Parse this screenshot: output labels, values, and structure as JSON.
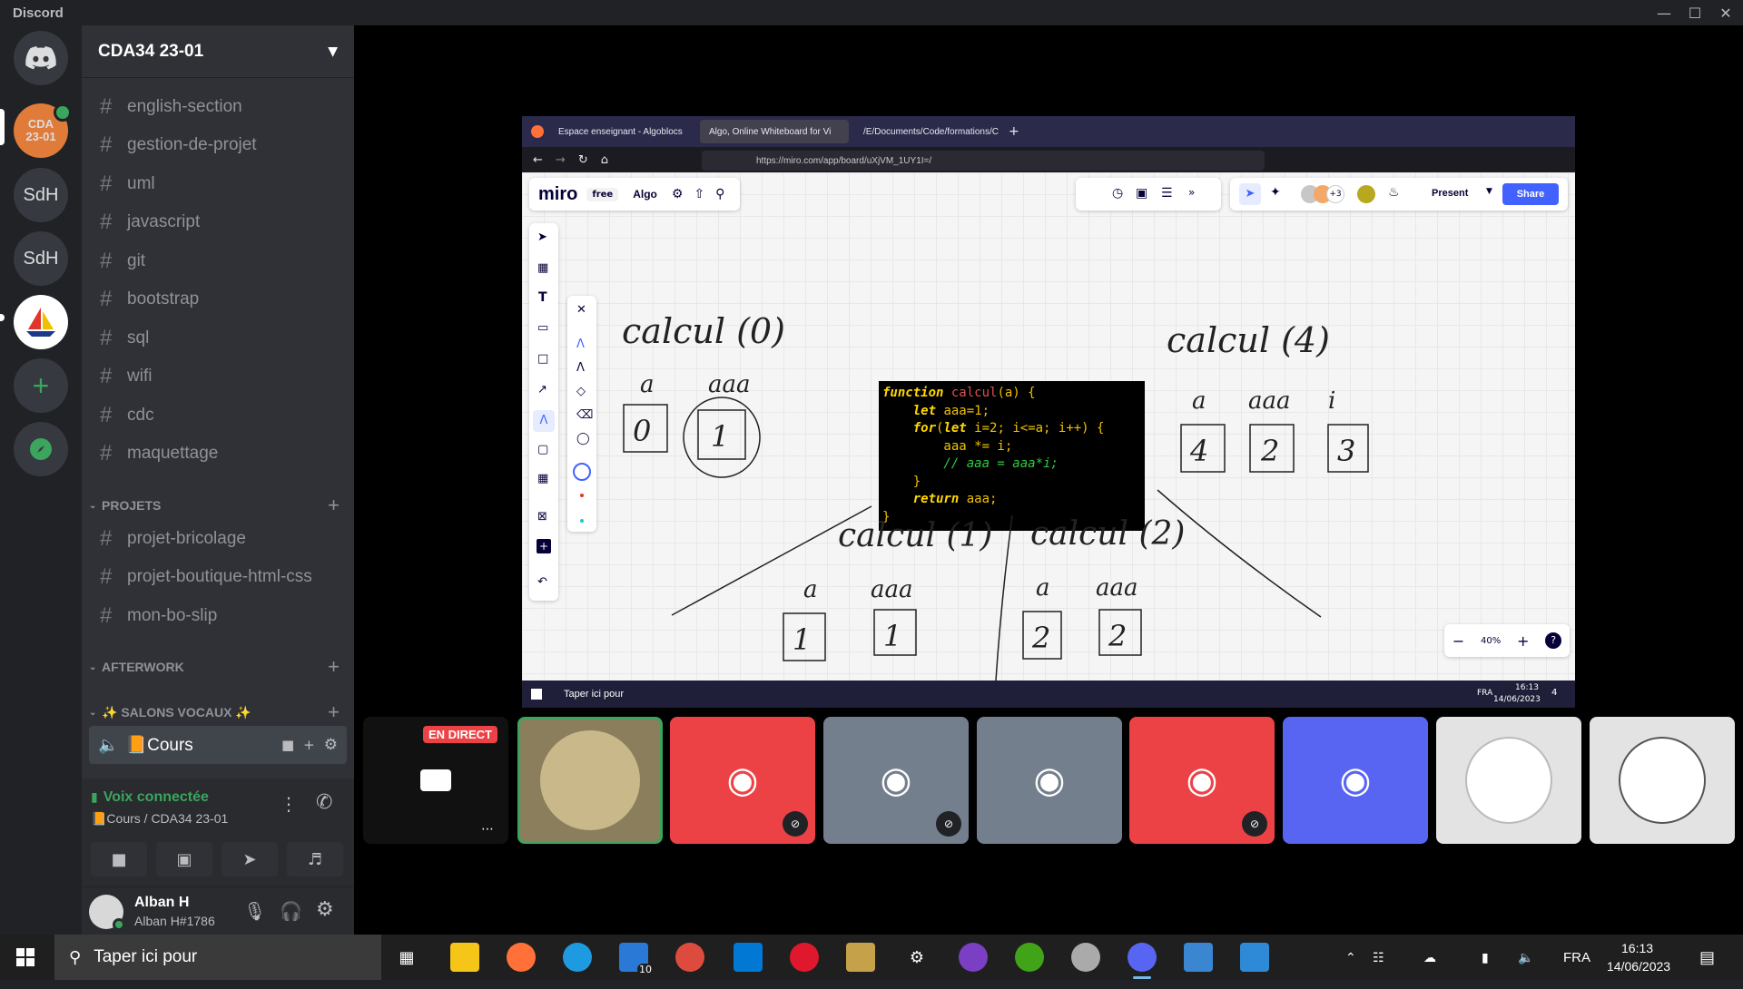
{
  "window": {
    "title": "Discord"
  },
  "servers": [
    {
      "label": ""
    },
    {
      "label": "CDA 23-01"
    },
    {
      "label": "SdH"
    },
    {
      "label": "SdH"
    },
    {
      "label": ""
    }
  ],
  "guild": {
    "name": "CDA34 23-01"
  },
  "channels": [
    "english-section",
    "gestion-de-projet",
    "uml",
    "javascript",
    "git",
    "bootstrap",
    "sql",
    "wifi",
    "cdc",
    "maquettage"
  ],
  "categories": {
    "projets": {
      "label": "PROJETS",
      "channels": [
        "projet-bricolage",
        "projet-boutique-html-css",
        "mon-bo-slip"
      ]
    },
    "afterwork": {
      "label": "AFTERWORK"
    },
    "vocaux": {
      "label": "✨ SALONS VOCAUX ✨"
    }
  },
  "voice_channel": {
    "label": "Cours",
    "emoji": "📙"
  },
  "voice_status": {
    "title": "Voix connectée",
    "subtitle": "📙Cours / CDA34 23-01"
  },
  "user": {
    "name": "Alban H",
    "tag": "Alban H#1786"
  },
  "stream": {
    "live_badge": "EN DIRECT"
  },
  "browser": {
    "tabs": [
      "Espace enseignant - Algoblocs",
      "Algo, Online Whiteboard for Vi",
      "/E/Documents/Code/formations/C"
    ],
    "url": "https://miro.com/app/board/uXjVM_1UY1I=/"
  },
  "miro": {
    "logo": "miro",
    "plan": "free",
    "board_name": "Algo",
    "avatar_count": "+3",
    "present_label": "Present",
    "share_label": "Share",
    "zoom": "40%",
    "code_lines": [
      "function calcul(a) {",
      "    let aaa=1;",
      "    for(let i=2; i<=a; i++) {",
      "        aaa *= i;",
      "        // aaa = aaa*i;",
      "    }",
      "    return aaa;",
      "}"
    ],
    "handwriting": {
      "c0": "calcul (0)",
      "c1": "calcul (1)",
      "c2": "calcul (2)",
      "c4": "calcul (4)",
      "a": "a",
      "aaa": "aaa",
      "i": "i",
      "v0_a": "0",
      "v0_aaa": "1",
      "v1_a": "1",
      "v1_aaa": "1",
      "v2_a": "2",
      "v2_aaa": "2",
      "v4_a": "4",
      "v4_aaa": "2",
      "v4_i": "3"
    }
  },
  "inner_taskbar": {
    "search": "Taper ici pour",
    "lang": "FRA",
    "time": "16:13",
    "date": "14/06/2023",
    "notif": "4"
  },
  "taskbar": {
    "search": "Taper ici pour",
    "lang": "FRA",
    "time": "16:13",
    "date": "14/06/2023",
    "mail_badge": "10"
  },
  "colors": {
    "discord_blurple": "#5865f2",
    "discord_red": "#ed4245",
    "discord_grey": "#747f8d",
    "green": "#3ba55d"
  }
}
